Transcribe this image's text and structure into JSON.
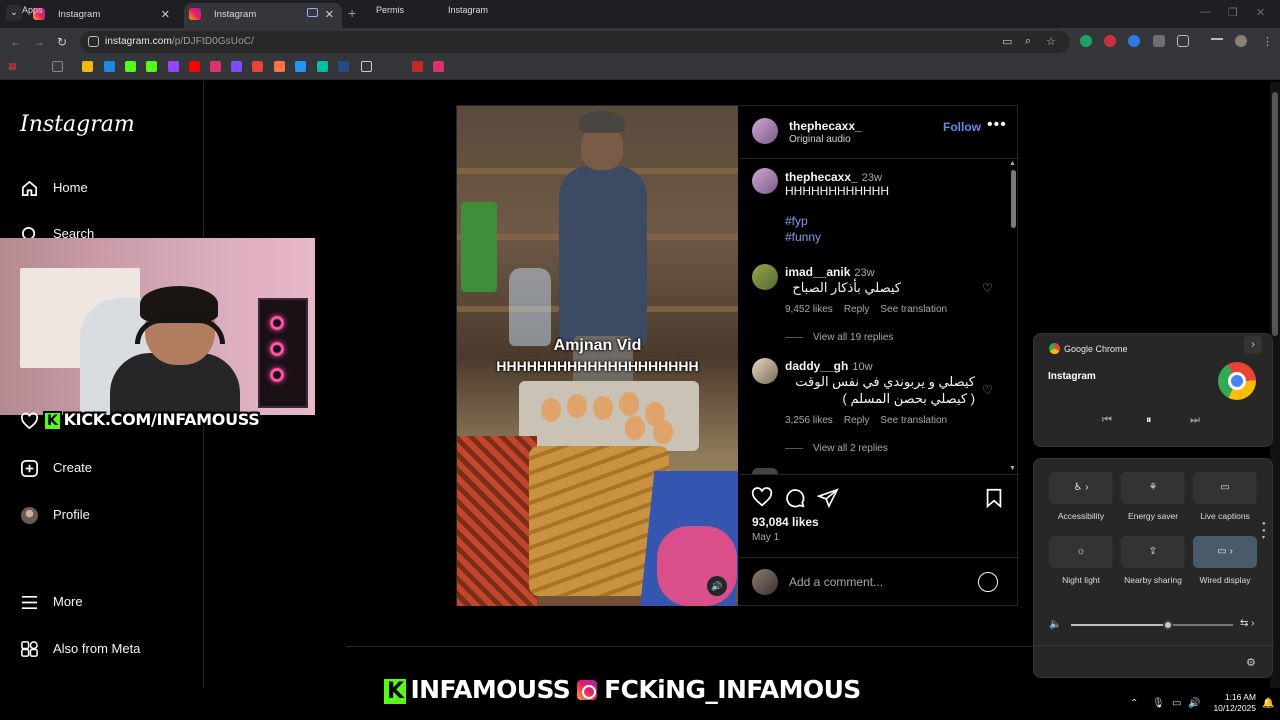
{
  "browser": {
    "tabs": [
      {
        "title": "Instagram",
        "active": false
      },
      {
        "title": "Instagram",
        "active": true
      }
    ],
    "url_host": "instagram.com",
    "url_path": "/p/DJFtD0GsUoC/",
    "bookmarks": {
      "apps": "Apps",
      "permis": "Permis",
      "instagram": "Instagram"
    }
  },
  "sidebar": {
    "logo": "Instagram",
    "items": [
      {
        "label": "Home",
        "icon": "home-icon"
      },
      {
        "label": "Search",
        "icon": "search-icon"
      },
      {
        "label": "Create",
        "icon": "create-icon"
      },
      {
        "label": "Profile",
        "icon": "profile-avatar"
      },
      {
        "label": "More",
        "icon": "hamburger-icon"
      },
      {
        "label": "Also from Meta",
        "icon": "meta-apps-icon"
      }
    ]
  },
  "post": {
    "author": "thephecaxx_",
    "audio": "Original audio",
    "follow_label": "Follow",
    "media_caption_1": "Amjnan Vid",
    "media_caption_2": "HHHHHHHHHHHHHHHHHHHH",
    "caption": {
      "user": "thephecaxx_",
      "time": "23w",
      "text": "HHHHHHHHHHHH",
      "tags": [
        "#fyp",
        "#funny"
      ]
    },
    "comments": [
      {
        "user": "imad__anik",
        "time": "23w",
        "text": "كيصلي بأذكار الصباح",
        "likes": "9,452 likes",
        "reply": "Reply",
        "translate": "See translation",
        "view_replies": "View all 19 replies"
      },
      {
        "user": "daddy__gh",
        "time": "10w",
        "text": "كيصلي و يربوندي في نفس الوقت",
        "text2": "( كيصلي بحصن المسلم )",
        "likes": "3,256 likes",
        "reply": "Reply",
        "translate": "See translation",
        "view_replies": "View all 2 replies"
      }
    ],
    "like_count": "93,084 likes",
    "date": "May 1",
    "add_comment_placeholder": "Add a comment..."
  },
  "overlay": {
    "cam_text": "KICK.COM/INFAMOUSS",
    "bottom_kick": "INFAMOUSS",
    "bottom_ig": "FCKiNG_INFAMOUS",
    "kick_badge": "K"
  },
  "media_panel": {
    "app": "Google Chrome",
    "title": "Instagram"
  },
  "quick_settings": {
    "tiles": [
      {
        "label": "Accessibility",
        "icon": "accessibility-icon",
        "on": false
      },
      {
        "label": "Energy saver",
        "icon": "energy-saver-icon",
        "on": false
      },
      {
        "label": "Live captions",
        "icon": "live-captions-icon",
        "on": false
      },
      {
        "label": "Night light",
        "icon": "night-light-icon",
        "on": false
      },
      {
        "label": "Nearby sharing",
        "icon": "nearby-sharing-icon",
        "on": false
      },
      {
        "label": "Wired display",
        "icon": "wired-display-icon",
        "on": true
      }
    ],
    "volume_level": 0.6
  },
  "taskbar": {
    "time": "1:16 AM",
    "date": "10/12/2025"
  }
}
